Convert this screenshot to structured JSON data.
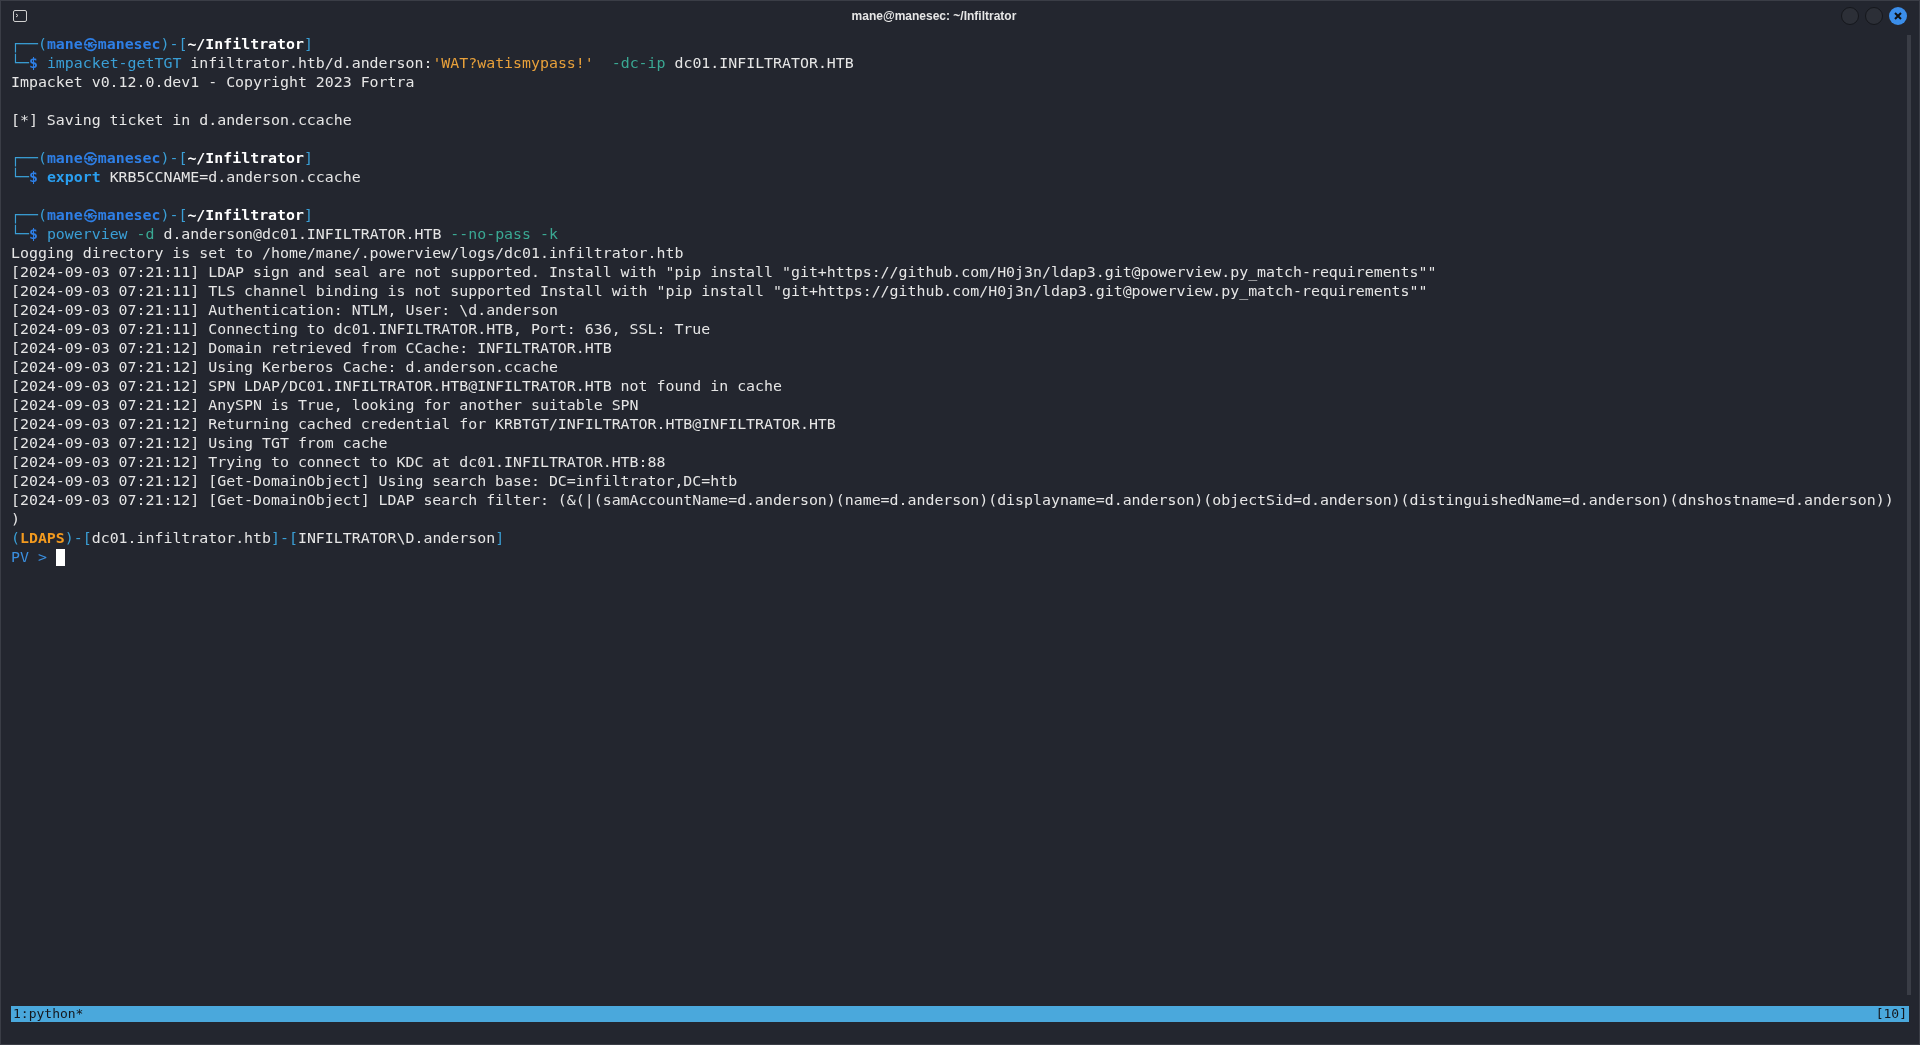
{
  "window": {
    "title": "mane@manesec: ~/Infiltrator"
  },
  "terminal": {
    "lines": [
      {
        "segments": [
          {
            "kind": "frame",
            "text": "┌──("
          },
          {
            "kind": "user",
            "text": "mane㉿manesec"
          },
          {
            "kind": "frame",
            "text": ")-["
          },
          {
            "kind": "path",
            "text": "~/Infiltrator"
          },
          {
            "kind": "frame",
            "text": "]"
          }
        ]
      },
      {
        "segments": [
          {
            "kind": "frame",
            "text": "└─"
          },
          {
            "kind": "user",
            "text": "$ "
          },
          {
            "kind": "command",
            "text": "impacket-getTGT"
          },
          {
            "kind": "plain",
            "text": " infiltrator.htb/d.anderson:"
          },
          {
            "kind": "string",
            "text": "'WAT?watismypass!'"
          },
          {
            "kind": "option",
            "text": "  -dc-ip"
          },
          {
            "kind": "plain",
            "text": " dc01.INFILTRATOR.HTB"
          }
        ]
      },
      {
        "segments": [
          {
            "kind": "plain",
            "text": "Impacket v0.12.0.dev1 - Copyright 2023 Fortra"
          }
        ]
      },
      {
        "blank": true
      },
      {
        "segments": [
          {
            "kind": "plain",
            "text": "[*] Saving ticket in d.anderson.ccache"
          }
        ]
      },
      {
        "blank": true
      },
      {
        "segments": [
          {
            "kind": "frame",
            "text": "┌──("
          },
          {
            "kind": "user",
            "text": "mane㉿manesec"
          },
          {
            "kind": "frame",
            "text": ")-["
          },
          {
            "kind": "path",
            "text": "~/Infiltrator"
          },
          {
            "kind": "frame",
            "text": "]"
          }
        ]
      },
      {
        "segments": [
          {
            "kind": "frame",
            "text": "└─"
          },
          {
            "kind": "user",
            "text": "$ "
          },
          {
            "kind": "keyword",
            "text": "export"
          },
          {
            "kind": "plain",
            "text": " KRB5CCNAME=d.anderson.ccache"
          }
        ]
      },
      {
        "blank": true
      },
      {
        "segments": [
          {
            "kind": "frame",
            "text": "┌──("
          },
          {
            "kind": "user",
            "text": "mane㉿manesec"
          },
          {
            "kind": "frame",
            "text": ")-["
          },
          {
            "kind": "path",
            "text": "~/Infiltrator"
          },
          {
            "kind": "frame",
            "text": "]"
          }
        ]
      },
      {
        "segments": [
          {
            "kind": "frame",
            "text": "└─"
          },
          {
            "kind": "user",
            "text": "$ "
          },
          {
            "kind": "command",
            "text": "powerview"
          },
          {
            "kind": "option",
            "text": " -d"
          },
          {
            "kind": "plain",
            "text": " d.anderson@dc01.INFILTRATOR.HTB "
          },
          {
            "kind": "option",
            "text": "--no-pass -k"
          }
        ]
      },
      {
        "segments": [
          {
            "kind": "plain",
            "text": "Logging directory is set to /home/mane/.powerview/logs/dc01.infiltrator.htb"
          }
        ]
      },
      {
        "segments": [
          {
            "kind": "plain",
            "text": "[2024-09-03 07:21:11] LDAP sign and seal are not supported. Install with \"pip install \"git+https://github.com/H0j3n/ldap3.git@powerview.py_match-requirements\"\""
          }
        ]
      },
      {
        "segments": [
          {
            "kind": "plain",
            "text": "[2024-09-03 07:21:11] TLS channel binding is not supported Install with \"pip install \"git+https://github.com/H0j3n/ldap3.git@powerview.py_match-requirements\"\""
          }
        ]
      },
      {
        "segments": [
          {
            "kind": "plain",
            "text": "[2024-09-03 07:21:11] Authentication: NTLM, User: \\d.anderson"
          }
        ]
      },
      {
        "segments": [
          {
            "kind": "plain",
            "text": "[2024-09-03 07:21:11] Connecting to dc01.INFILTRATOR.HTB, Port: 636, SSL: True"
          }
        ]
      },
      {
        "segments": [
          {
            "kind": "plain",
            "text": "[2024-09-03 07:21:12] Domain retrieved from CCache: INFILTRATOR.HTB"
          }
        ]
      },
      {
        "segments": [
          {
            "kind": "plain",
            "text": "[2024-09-03 07:21:12] Using Kerberos Cache: d.anderson.ccache"
          }
        ]
      },
      {
        "segments": [
          {
            "kind": "plain",
            "text": "[2024-09-03 07:21:12] SPN LDAP/DC01.INFILTRATOR.HTB@INFILTRATOR.HTB not found in cache"
          }
        ]
      },
      {
        "segments": [
          {
            "kind": "plain",
            "text": "[2024-09-03 07:21:12] AnySPN is True, looking for another suitable SPN"
          }
        ]
      },
      {
        "segments": [
          {
            "kind": "plain",
            "text": "[2024-09-03 07:21:12] Returning cached credential for KRBTGT/INFILTRATOR.HTB@INFILTRATOR.HTB"
          }
        ]
      },
      {
        "segments": [
          {
            "kind": "plain",
            "text": "[2024-09-03 07:21:12] Using TGT from cache"
          }
        ]
      },
      {
        "segments": [
          {
            "kind": "plain",
            "text": "[2024-09-03 07:21:12] Trying to connect to KDC at dc01.INFILTRATOR.HTB:88"
          }
        ]
      },
      {
        "segments": [
          {
            "kind": "plain",
            "text": "[2024-09-03 07:21:12] [Get-DomainObject] Using search base: DC=infiltrator,DC=htb"
          }
        ]
      },
      {
        "segments": [
          {
            "kind": "plain",
            "text": "[2024-09-03 07:21:12] [Get-DomainObject] LDAP search filter: (&(|(samAccountName=d.anderson)(name=d.anderson)(displayname=d.anderson)(objectSid=d.anderson)(distinguishedName=d.anderson)(dnshostname=d.anderson))"
          }
        ]
      },
      {
        "segments": [
          {
            "kind": "plain",
            "text": ")"
          }
        ]
      },
      {
        "segments": [
          {
            "kind": "frame",
            "text": "("
          },
          {
            "kind": "ldaps",
            "text": "LDAPS"
          },
          {
            "kind": "frame",
            "text": ")-["
          },
          {
            "kind": "plain",
            "text": "dc01.infiltrator.htb"
          },
          {
            "kind": "frame",
            "text": "]-["
          },
          {
            "kind": "plain",
            "text": "INFILTRATOR\\D.anderson"
          },
          {
            "kind": "frame",
            "text": "]"
          }
        ]
      },
      {
        "segments": [
          {
            "kind": "pv",
            "text": "PV > "
          }
        ],
        "cursor": true
      }
    ]
  },
  "status_bar": {
    "window": "1:python*",
    "count": "[10]"
  }
}
